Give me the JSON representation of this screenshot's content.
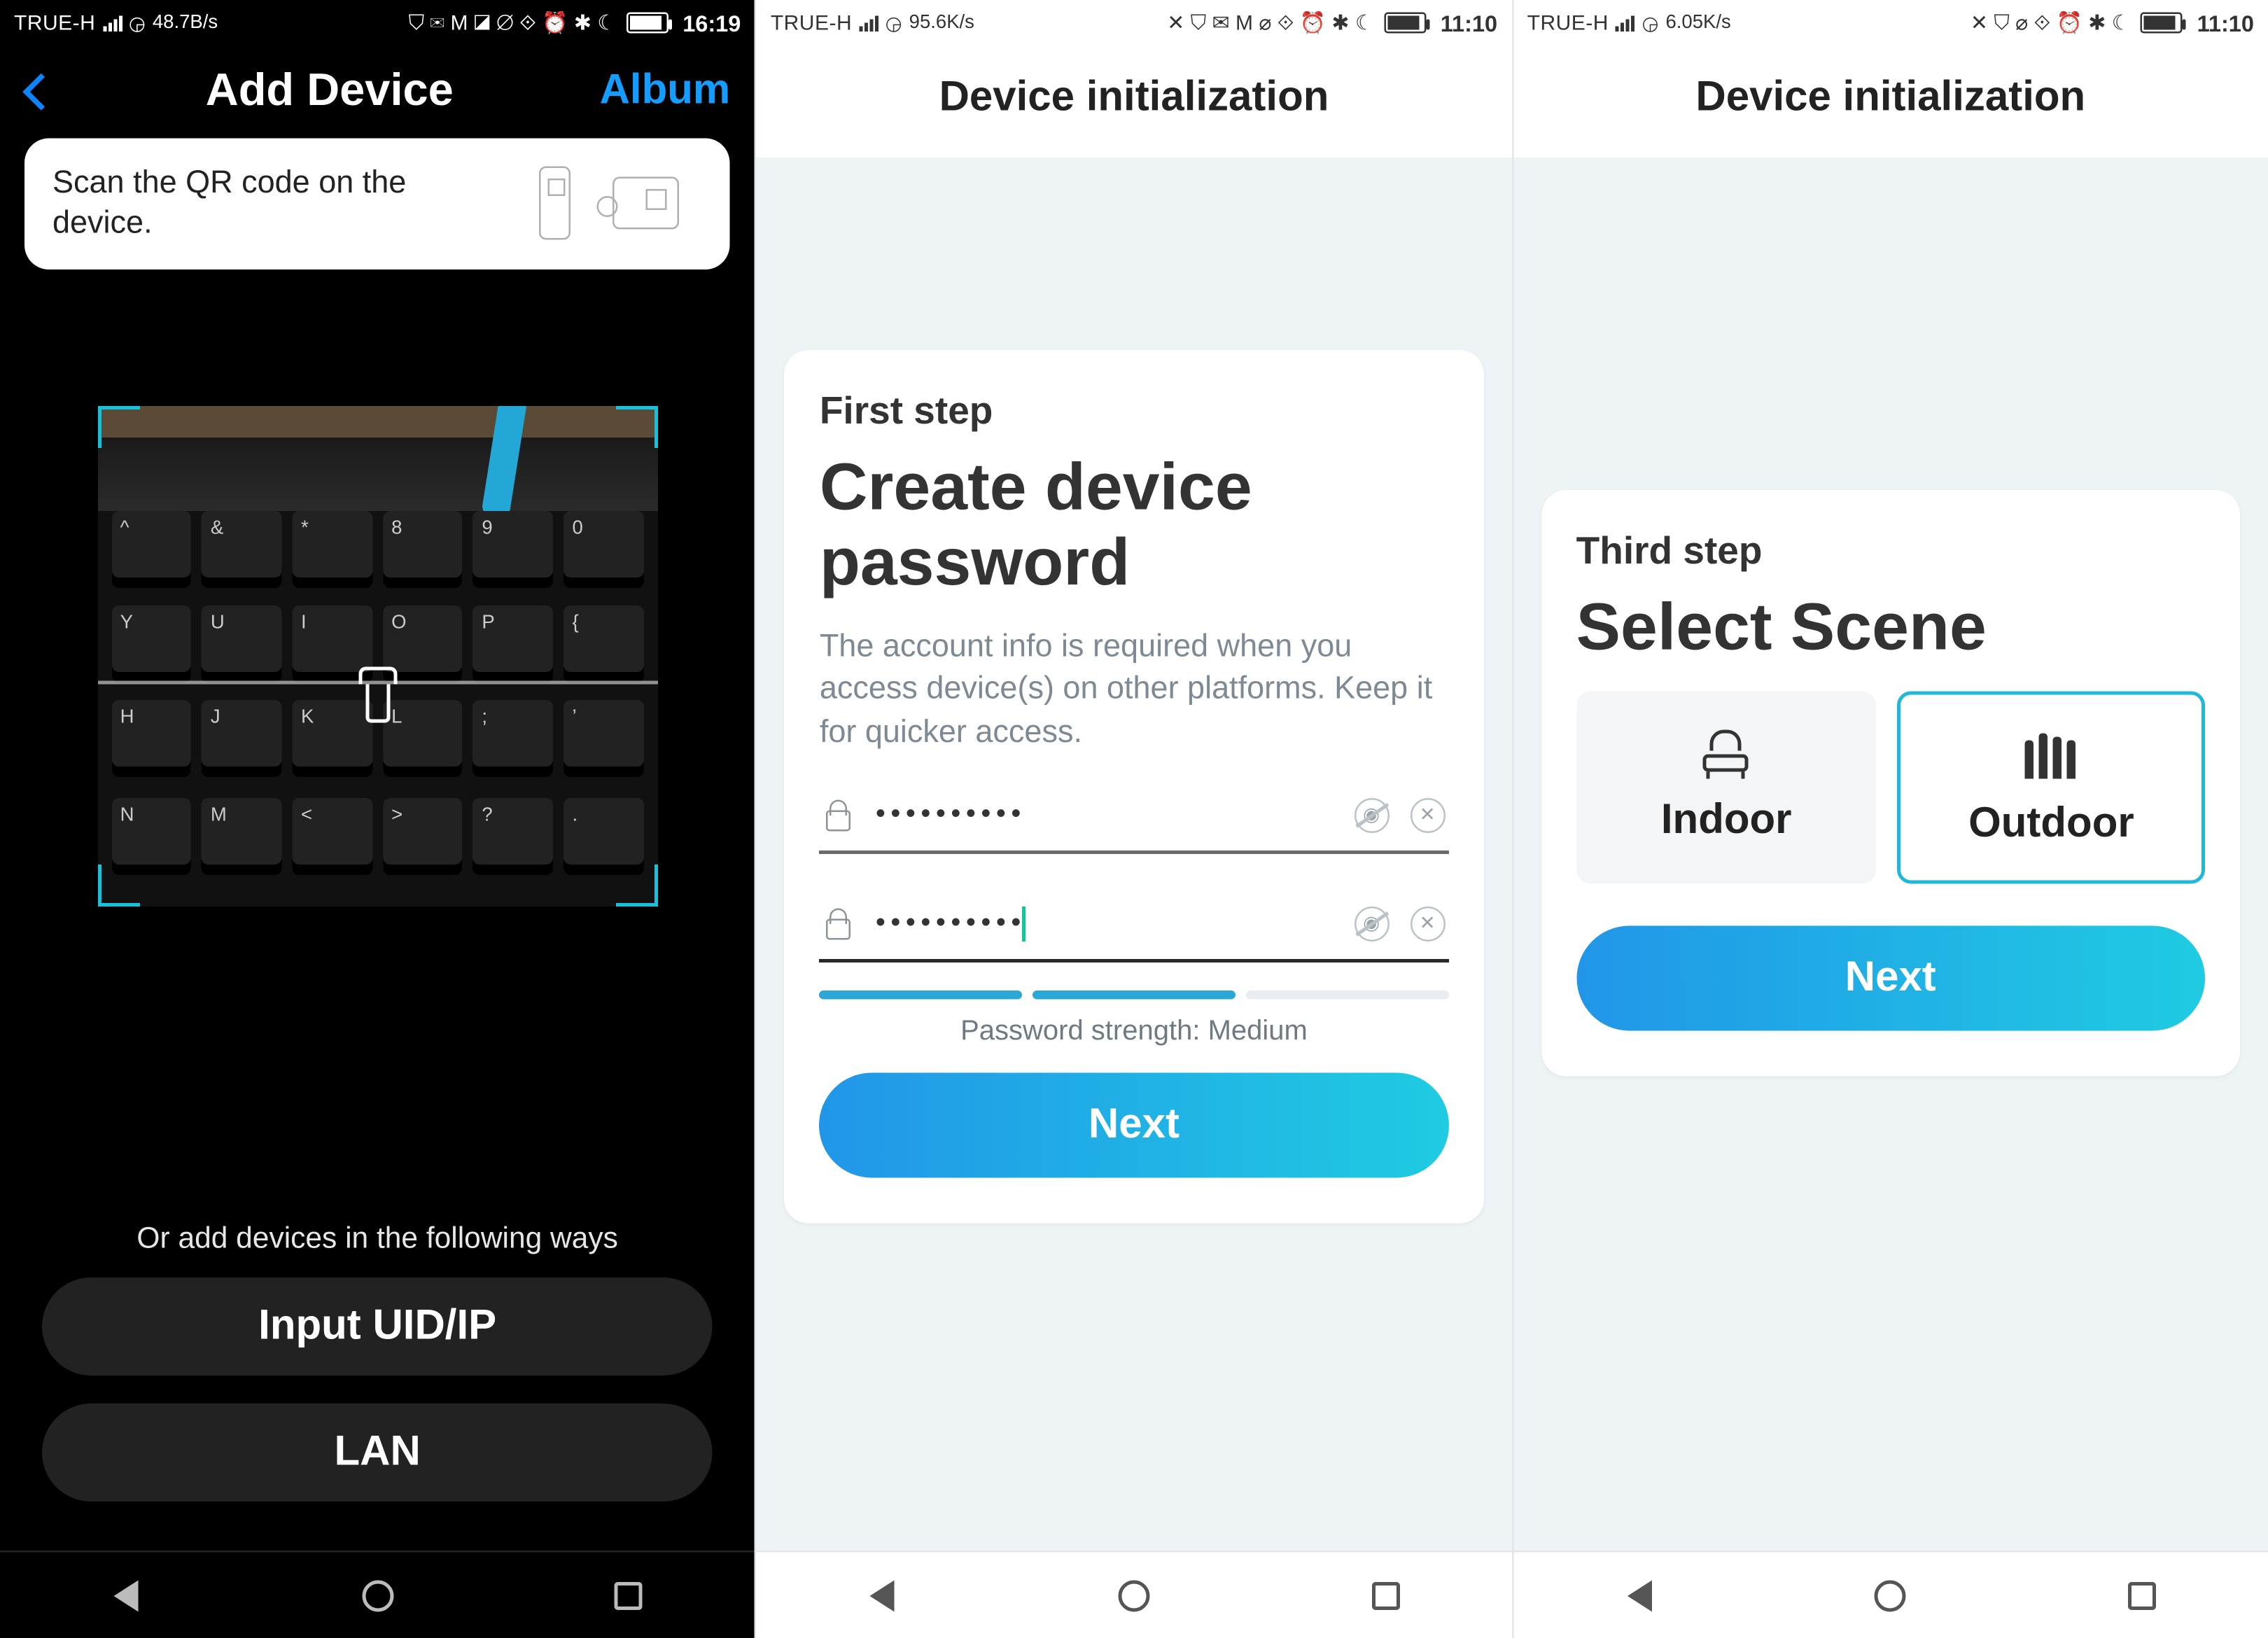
{
  "phone1": {
    "statusbar": {
      "carrier": "TRUE-H",
      "speed": "48.7B/s",
      "time": "16:19",
      "icons": "⛉ ✉ M ◪ ⌀ ⟐ ⏰ ✱ ☾"
    },
    "header": {
      "title": "Add Device",
      "album": "Album"
    },
    "tip": "Scan the QR code on the device.",
    "camera_keys": {
      "r1": [
        "^",
        "&",
        "*",
        "8",
        "9",
        "0"
      ],
      "r2": [
        "Y",
        "U",
        "I",
        "O",
        "P",
        "{"
      ],
      "r3": [
        "H",
        "J",
        "K",
        "L",
        ";",
        "’"
      ],
      "r4": [
        "N",
        "M",
        "<",
        ">",
        "?",
        "."
      ]
    },
    "alt_label": "Or add devices in the following ways",
    "btn_uid": "Input UID/IP",
    "btn_lan": "LAN"
  },
  "phone2": {
    "statusbar": {
      "carrier": "TRUE-H",
      "speed": "95.6K/s",
      "time": "11:10",
      "icons": "✕ ⛉ ✉ M ⌀ ⟐ ⏰ ✱ ☾"
    },
    "header": "Device initialization",
    "step": "First step",
    "title": "Create device password",
    "desc": "The account info is required when you access device(s) on other platforms. Keep it for quicker access.",
    "pw1": "••••••••••",
    "pw2": "••••••••••",
    "strength_label": "Password strength: Medium",
    "next": "Next"
  },
  "phone3": {
    "statusbar": {
      "carrier": "TRUE-H",
      "speed": "6.05K/s",
      "time": "11:10",
      "icons": "✕ ⛉ ⌀ ⟐ ⏰ ✱ ☾"
    },
    "header": "Device initialization",
    "step": "Third step",
    "title": "Select Scene",
    "scene_indoor": "Indoor",
    "scene_outdoor": "Outdoor",
    "next": "Next"
  }
}
